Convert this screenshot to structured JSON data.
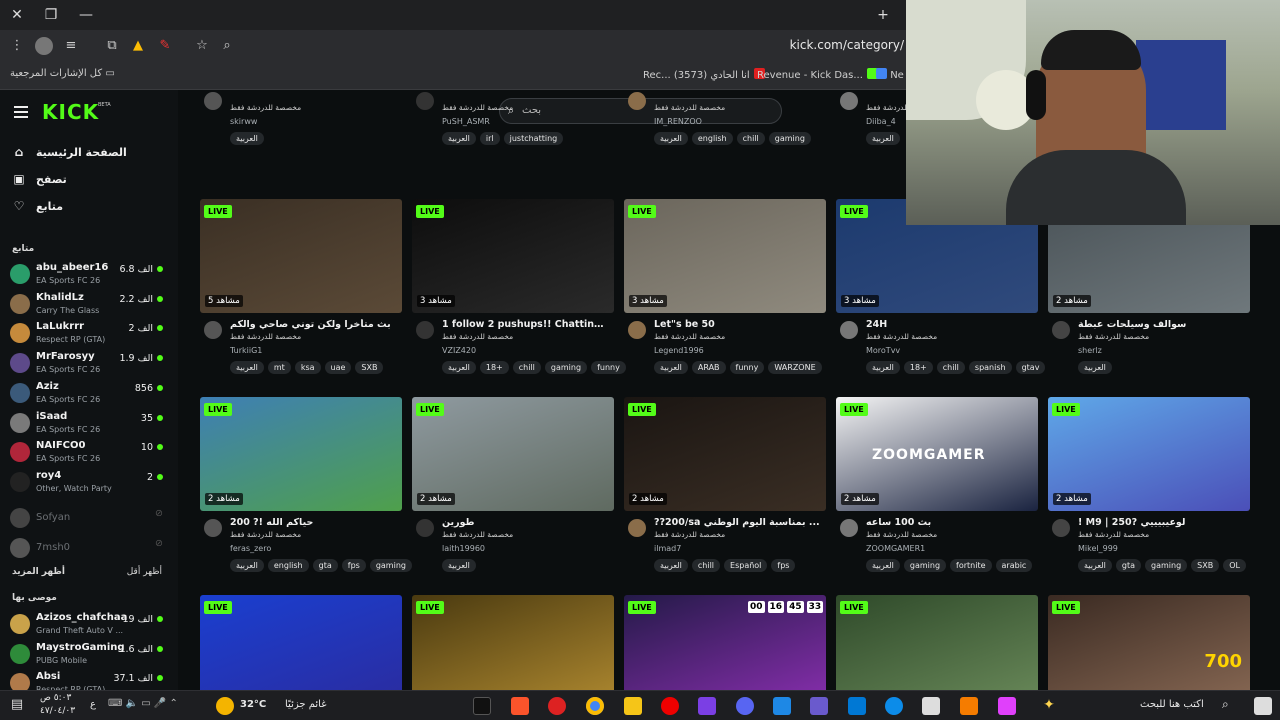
{
  "browser": {
    "url": "kick.com/category/",
    "bookmarks_all": "كل الإشارات المرجعية",
    "bookmarks": [
      "Rec... انا الحادي (3573)",
      "Revenue - Kick Das...",
      "Ne"
    ]
  },
  "kick": {
    "logo": "KICK",
    "beta": "BETA",
    "search_placeholder": "بحث",
    "nav": [
      "الصفحة الرئيسية",
      "تصفح",
      "متابع"
    ],
    "following_title": "متابع",
    "show_more": "أظهر المزيد",
    "show_less": "أظهر أقل",
    "recommended_title": "موصى بها",
    "following": [
      {
        "name": "abu_abeer16",
        "game": "EA Sports FC 26",
        "count": "6.8 الف",
        "color": "#2a9d6a"
      },
      {
        "name": "KhalidLz",
        "game": "Carry The Glass",
        "count": "2.2 الف",
        "color": "#8a6d4a"
      },
      {
        "name": "LaLukrrr",
        "game": "Respect RP (GTA)",
        "count": "2 الف",
        "color": "#c58a3c"
      },
      {
        "name": "MrFarosyy",
        "game": "EA Sports FC 26",
        "count": "1.9 الف",
        "color": "#5d4a8a"
      },
      {
        "name": "Aziz",
        "game": "EA Sports FC 26",
        "count": "856",
        "color": "#3b5a7a"
      },
      {
        "name": "iSaad",
        "game": "EA Sports FC 26",
        "count": "35",
        "color": "#7a7a7a"
      },
      {
        "name": "NAIFCO0",
        "game": "EA Sports FC 26",
        "count": "10",
        "color": "#b0263a"
      },
      {
        "name": "roy4",
        "game": "Other, Watch Party",
        "count": "2",
        "color": "#222222"
      }
    ],
    "offline": [
      {
        "name": "Sofyan",
        "color": "#444"
      },
      {
        "name": "7msh0",
        "color": "#555"
      }
    ],
    "recommended": [
      {
        "name": "Azizos_chafchaa",
        "game": "Grand Theft Auto V ...",
        "count": "19 الف",
        "color": "#c9a24a"
      },
      {
        "name": "MaystroGaming",
        "game": "PUBG Mobile",
        "count": "1.6 الف",
        "color": "#2e8b3a"
      },
      {
        "name": "Absi",
        "game": "Respect RP (GTA)",
        "count": "37.1 الف",
        "color": "#b07a4a"
      }
    ],
    "top_row": [
      {
        "user": "skirww",
        "cat": "مخصصة للدردشة فقط",
        "tags": [
          "العربية"
        ]
      },
      {
        "user": "PuSH_ASMR",
        "cat": "مخصصة للدردشة فقط",
        "tags": [
          "العربية",
          "irl",
          "justchatting"
        ]
      },
      {
        "user": "IM_RENZOO",
        "cat": "مخصصة للدردشة فقط",
        "tags": [
          "العربية",
          "english",
          "chill",
          "gaming"
        ]
      },
      {
        "user": "Diiba_4",
        "cat": "مخصصة للدردشة فقط",
        "tags": [
          "العربية"
        ]
      }
    ],
    "row1": [
      {
        "title": "بث متأخرا ولكن توني صاحي والكم",
        "cat": "مخصصة للدردشة فقط",
        "user": "TurkiiG1",
        "viewers": "5 مشاهد",
        "tags": [
          "العربية",
          "mt",
          "ksa",
          "uae",
          "SXB"
        ]
      },
      {
        "title": "1 follow 2 pushups!! Chatting & c...",
        "cat": "مخصصة للدردشة فقط",
        "user": "VZIZ420",
        "viewers": "3 مشاهد",
        "tags": [
          "العربية",
          "18+",
          "chill",
          "gaming",
          "funny"
        ]
      },
      {
        "title": "Let\"s be 50",
        "cat": "مخصصة للدردشة فقط",
        "user": "Legend1996",
        "viewers": "3 مشاهد",
        "tags": [
          "العربية",
          "ARAB",
          "funny",
          "WARZONE"
        ]
      },
      {
        "title": "24H",
        "cat": "مخصصة للدردشة فقط",
        "user": "MoroTvv",
        "viewers": "3 مشاهد",
        "tags": [
          "العربية",
          "18+",
          "chill",
          "spanish",
          "gtav"
        ]
      },
      {
        "title": "سوالف وسيلحات عبطة",
        "cat": "مخصصة للدردشة فقط",
        "user": "sherlz",
        "viewers": "2 مشاهد",
        "tags": [
          "العربية"
        ]
      }
    ],
    "row2": [
      {
        "title": "حياكم الله !? 200",
        "cat": "مخصصة للدردشة فقط",
        "user": "feras_zero",
        "viewers": "2 مشاهد",
        "tags": [
          "العربية",
          "english",
          "gta",
          "fps",
          "gaming"
        ]
      },
      {
        "title": "طورين",
        "cat": "مخصصة للدردشة فقط",
        "user": "laith19960",
        "viewers": "2 مشاهد",
        "tags": [
          "العربية"
        ]
      },
      {
        "title": "??200/sa بمناسبة اليوم الوطني ...",
        "cat": "مخصصة للدردشة فقط",
        "user": "ilmad7",
        "viewers": "2 مشاهد",
        "tags": [
          "العربية",
          "chill",
          "Español",
          "fps"
        ]
      },
      {
        "title": "بث 100 ساعه",
        "cat": "مخصصة للدردشة فقط",
        "user": "ZOOMGAMER1",
        "viewers": "2 مشاهد",
        "tags": [
          "العربية",
          "gaming",
          "fortnite",
          "arabic"
        ]
      },
      {
        "title": "! M9 | 250? لوعيبيييي",
        "cat": "مخصصة للدردشة فقط",
        "user": "Mikel_999",
        "viewers": "2 مشاهد",
        "tags": [
          "العربية",
          "gta",
          "gaming",
          "SXB",
          "OL"
        ]
      }
    ],
    "live": "LIVE",
    "zoomgamer": "ZOOMGAMER",
    "timer": [
      "00",
      "16",
      "45",
      "33"
    ],
    "overlay_700": "700"
  },
  "taskbar": {
    "search": "اكتب هنا للبحث",
    "weather": "32°C",
    "weather_desc": "غائم جزئيًا",
    "time": "٥:٠٣ ص",
    "date": "٤٧/٠٤/٠٣",
    "lang": "ع"
  }
}
